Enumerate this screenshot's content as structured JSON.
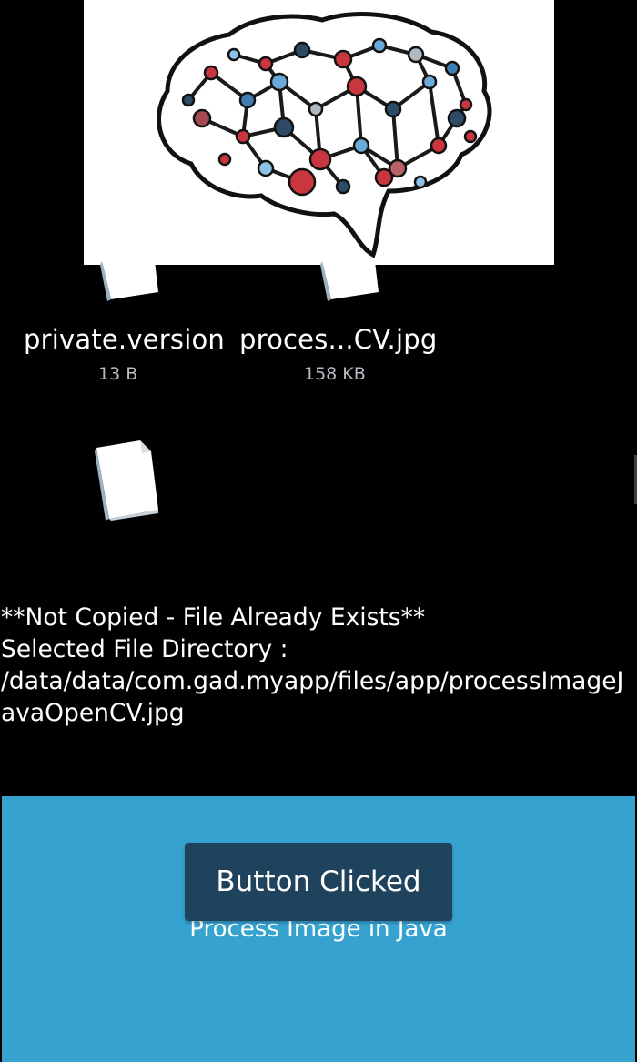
{
  "preview": {
    "icon": "brain-network-image"
  },
  "files": [
    {
      "name": "private.version",
      "size": "13 B",
      "icon": "file-icon"
    },
    {
      "name": "proces...CV.jpg",
      "size": "158 KB",
      "icon": "file-icon"
    },
    {
      "name": "",
      "size": "",
      "icon": "file-icon"
    }
  ],
  "status": {
    "line1": "**Not Copied - File Already Exists**",
    "line2": "Selected File Directory :",
    "line3": "/data/data/com.gad.myapp/files/app/processImageJavaOpenCV.jpg"
  },
  "actions": {
    "button_label": "Button Clicked",
    "process_label": "Process Image in Java"
  },
  "colors": {
    "background": "#000000",
    "panel": "#35a2d0",
    "button": "#1f435c"
  }
}
